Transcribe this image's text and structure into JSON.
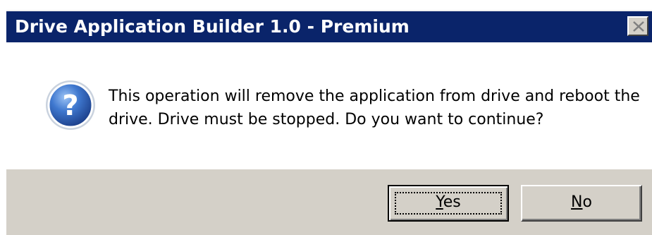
{
  "window": {
    "title": "Drive Application Builder 1.0 - Premium",
    "close_icon": "close-icon"
  },
  "message": {
    "icon": "question-icon",
    "text": "This operation will remove the application from drive and reboot the drive. Drive must be stopped. Do you want to continue?"
  },
  "buttons": {
    "yes": {
      "label": "Yes",
      "accelerator": "Y"
    },
    "no": {
      "label": "No",
      "accelerator": "N"
    }
  },
  "colors": {
    "titlebar": "#0a246a",
    "titlebar_text": "#ffffff",
    "dialog_face": "#d4d0c8",
    "icon_blue": "#2a5fb0"
  }
}
